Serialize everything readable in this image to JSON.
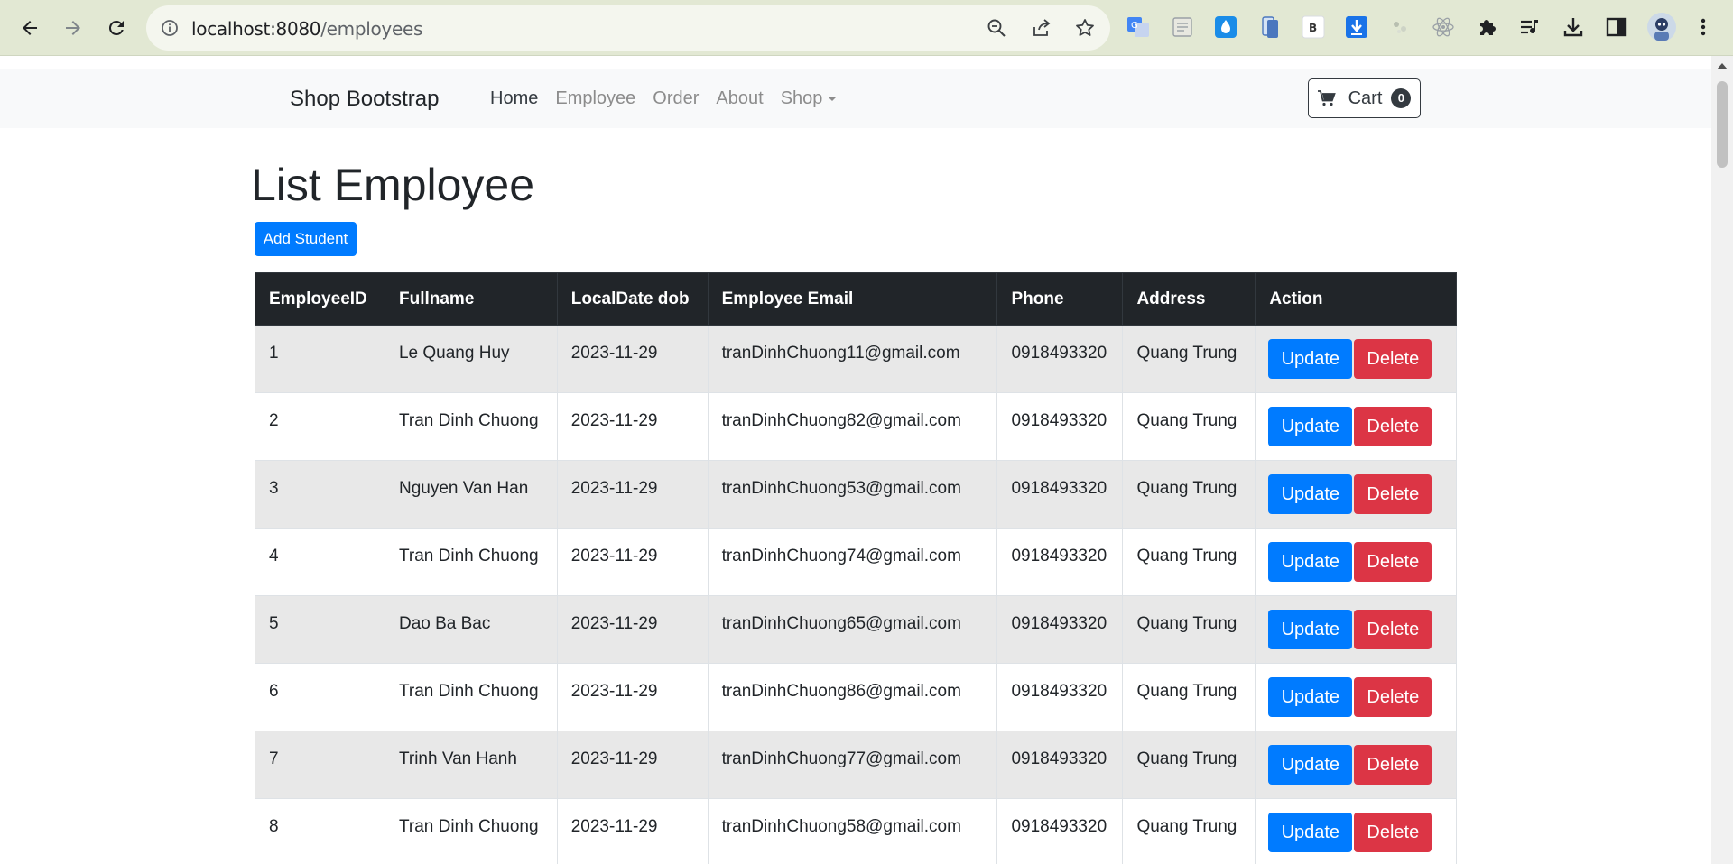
{
  "browser": {
    "url_host": "localhost:8080",
    "url_path": "/employees"
  },
  "navbar": {
    "brand": "Shop Bootstrap",
    "links": [
      {
        "label": "Home"
      },
      {
        "label": "Employee"
      },
      {
        "label": "Order"
      },
      {
        "label": "About"
      },
      {
        "label": "Shop"
      }
    ],
    "cart_label": "Cart",
    "cart_count": "0"
  },
  "main": {
    "title": "List Employee",
    "add_button": "Add Student",
    "columns": [
      "EmployeeID",
      "Fullname",
      "LocalDate dob",
      "Employee Email",
      "Phone",
      "Address",
      "Action"
    ],
    "update_label": "Update",
    "delete_label": "Delete",
    "rows": [
      {
        "id": "1",
        "fullname": "Le Quang Huy",
        "dob": "2023-11-29",
        "email": "tranDinhChuong11@gmail.com",
        "phone": "0918493320",
        "address": "Quang Trung"
      },
      {
        "id": "2",
        "fullname": "Tran Dinh Chuong",
        "dob": "2023-11-29",
        "email": "tranDinhChuong82@gmail.com",
        "phone": "0918493320",
        "address": "Quang Trung"
      },
      {
        "id": "3",
        "fullname": "Nguyen Van Han",
        "dob": "2023-11-29",
        "email": "tranDinhChuong53@gmail.com",
        "phone": "0918493320",
        "address": "Quang Trung"
      },
      {
        "id": "4",
        "fullname": "Tran Dinh Chuong",
        "dob": "2023-11-29",
        "email": "tranDinhChuong74@gmail.com",
        "phone": "0918493320",
        "address": "Quang Trung"
      },
      {
        "id": "5",
        "fullname": "Dao Ba Bac",
        "dob": "2023-11-29",
        "email": "tranDinhChuong65@gmail.com",
        "phone": "0918493320",
        "address": "Quang Trung"
      },
      {
        "id": "6",
        "fullname": "Tran Dinh Chuong",
        "dob": "2023-11-29",
        "email": "tranDinhChuong86@gmail.com",
        "phone": "0918493320",
        "address": "Quang Trung"
      },
      {
        "id": "7",
        "fullname": "Trinh Van Hanh",
        "dob": "2023-11-29",
        "email": "tranDinhChuong77@gmail.com",
        "phone": "0918493320",
        "address": "Quang Trung"
      },
      {
        "id": "8",
        "fullname": "Tran Dinh Chuong",
        "dob": "2023-11-29",
        "email": "tranDinhChuong58@gmail.com",
        "phone": "0918493320",
        "address": "Quang Trung"
      }
    ]
  },
  "colors": {
    "primary": "#007bff",
    "danger": "#dc3545",
    "dark": "#212529",
    "chrome": "#e2e8d3"
  },
  "icons": [
    "back-icon",
    "forward-icon",
    "reload-icon",
    "info-icon",
    "zoom-out-icon",
    "share-icon",
    "bookmark-star-icon",
    "translate-extension-icon",
    "reader-extension-icon",
    "drop-extension-icon",
    "phone-extension-icon",
    "bootstrap-extension-icon",
    "download-extension-icon",
    "dots-extension-icon",
    "react-extension-icon",
    "puzzle-extensions-icon",
    "media-queue-icon",
    "downloads-icon",
    "side-panel-icon",
    "profile-avatar-icon",
    "more-menu-icon",
    "cart-icon"
  ]
}
